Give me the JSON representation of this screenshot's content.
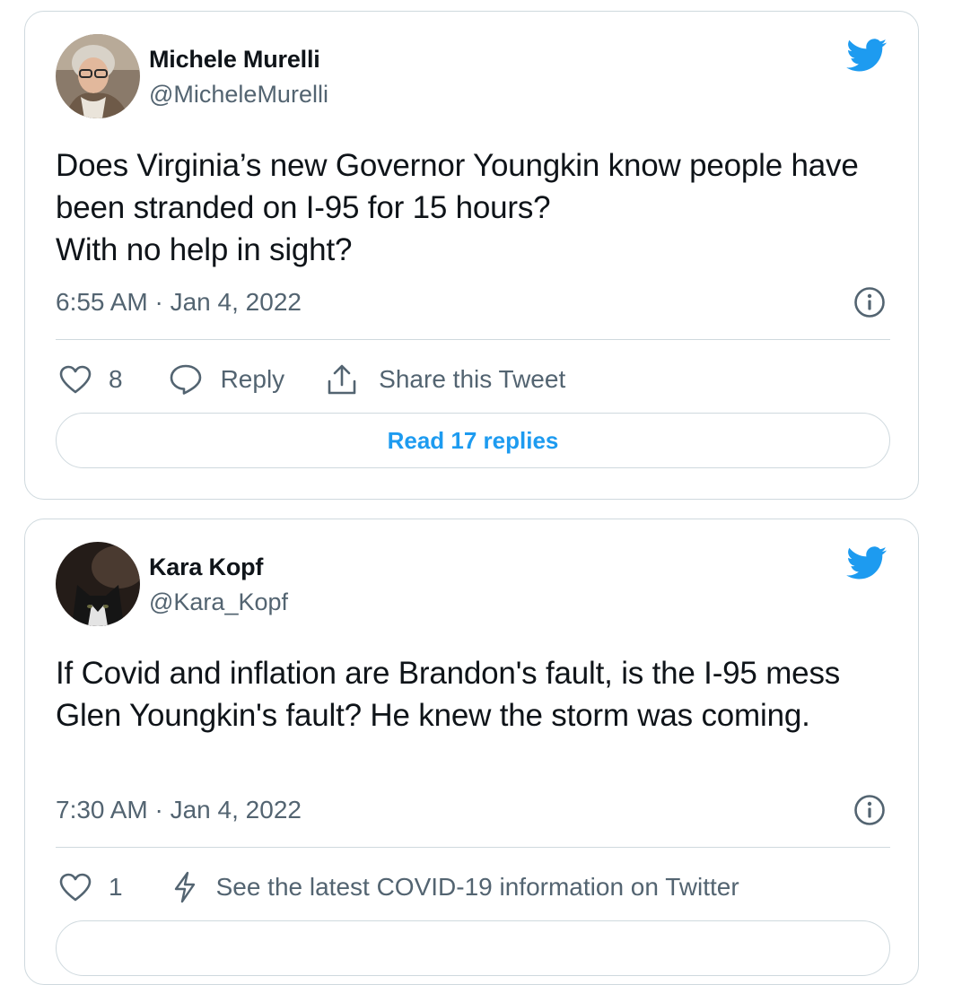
{
  "colors": {
    "twitter_blue": "#1d9bf0",
    "secondary_text": "#536471",
    "border": "#cfd9de"
  },
  "icons": {
    "logo": "twitter-bird-icon",
    "like": "heart-icon",
    "reply": "speech-bubble-icon",
    "share": "share-icon",
    "info": "info-icon",
    "bolt": "lightning-icon"
  },
  "tweets": [
    {
      "author": "Michele Murelli",
      "handle": "@MicheleMurelli",
      "text": "Does Virginia’s new Governor Youngkin know people have been stranded on I-95 for 15 hours?\nWith no help in sight?",
      "timestamp": "6:55 AM · Jan 4, 2022",
      "likes": "8",
      "reply_label": "Reply",
      "share_label": "Share this Tweet",
      "read_replies_label": "Read 17 replies"
    },
    {
      "author": "Kara Kopf",
      "handle": "@Kara_Kopf",
      "text": "If Covid and inflation are Brandon's fault, is the I-95 mess Glen Youngkin's fault? He knew the storm was coming.",
      "timestamp": "7:30 AM · Jan 4, 2022",
      "likes": "1",
      "covid_info_label": "See the latest COVID-19 information on Twitter"
    }
  ]
}
